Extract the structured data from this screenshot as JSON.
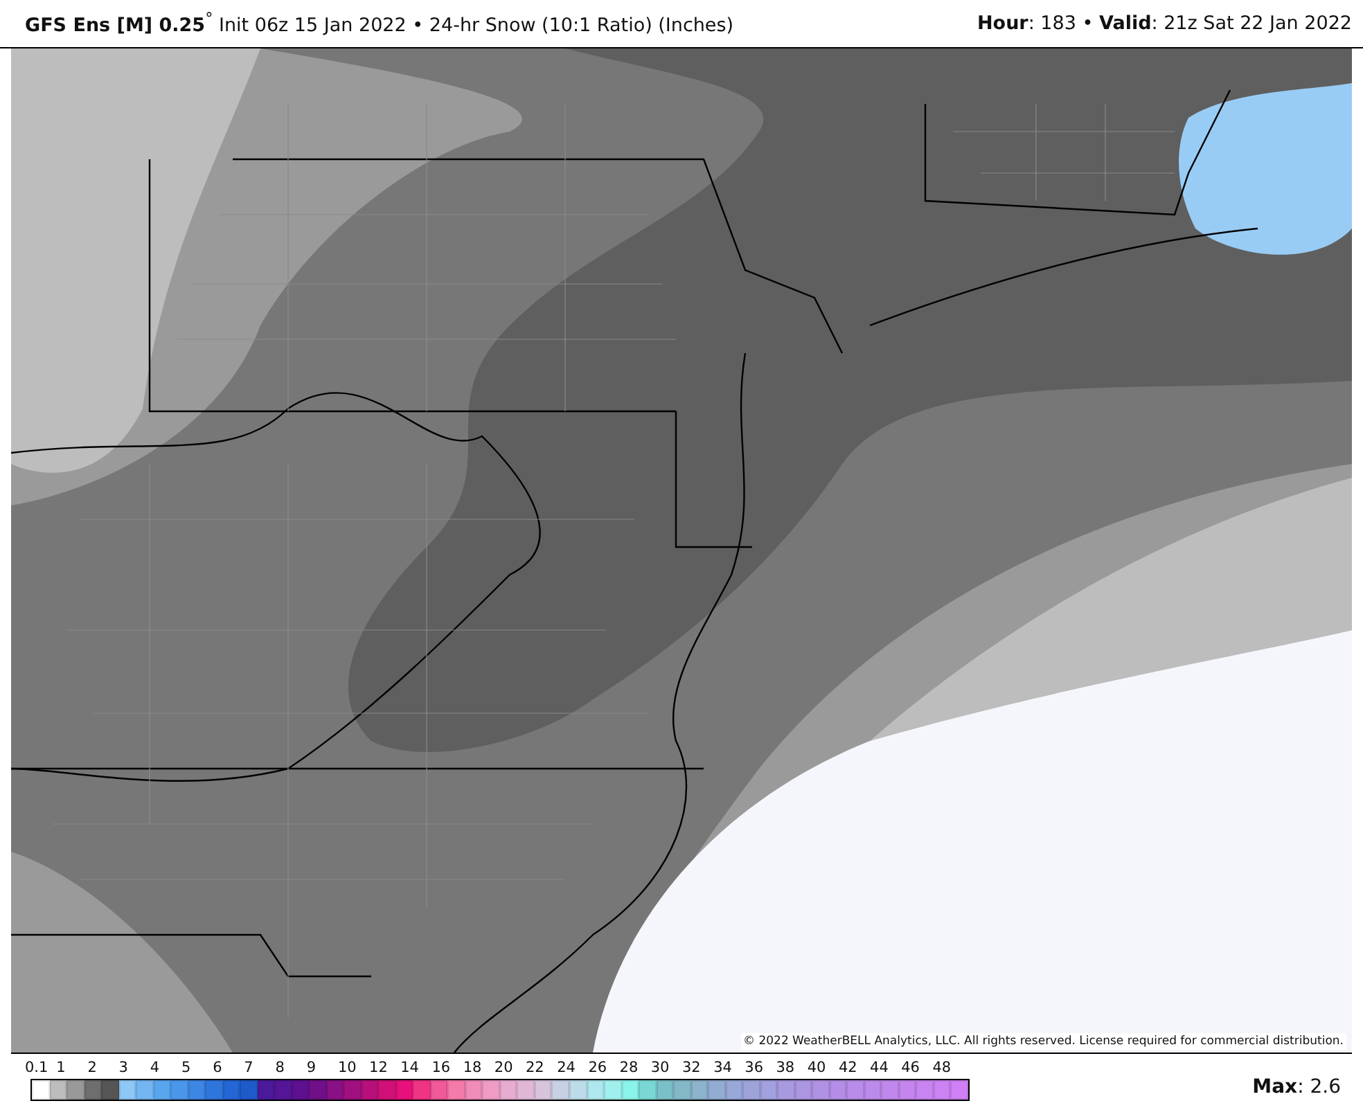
{
  "header": {
    "title": "**GFS Ens [M] 0.25**$^{°}$ Init 06z 15 Jan 2022 • 24-hr Snow (10:1 Ratio) (Inches)",
    "valid": "**Hour**: 183 • **Valid**: 21z Sat 22 Jan 2022"
  },
  "map": {
    "copyright": "© 2022 WeatherBELL Analytics, LLC. All rights reserved. License required for commercial distribution."
  },
  "legend": {
    "ticks": [
      "0.1",
      "1",
      "2",
      "3",
      "4",
      "5",
      "6",
      "7",
      "8",
      "9",
      "10",
      "12",
      "14",
      "16",
      "18",
      "20",
      "22",
      "24",
      "26",
      "28",
      "30",
      "32",
      "34",
      "36",
      "38",
      "40",
      "42",
      "44",
      "46",
      "48"
    ],
    "swatches": [
      {
        "color": "#ffffff"
      },
      {
        "color": "#bdbdbd"
      },
      {
        "color": "#999999"
      },
      {
        "color": "#6e6e6e"
      },
      {
        "color": "#555555"
      },
      {
        "color": "#8ec8f6"
      },
      {
        "color": "#74b6f2"
      },
      {
        "color": "#5aa6ee"
      },
      {
        "color": "#4a96ea"
      },
      {
        "color": "#3d86e4"
      },
      {
        "color": "#2f76dc"
      },
      {
        "color": "#2466d4"
      },
      {
        "color": "#1e5ac8"
      },
      {
        "color": "#4a1a9a"
      },
      {
        "color": "#541596"
      },
      {
        "color": "#5e1090"
      },
      {
        "color": "#701088"
      },
      {
        "color": "#8a1085"
      },
      {
        "color": "#a0107e"
      },
      {
        "color": "#b8107a"
      },
      {
        "color": "#d01078"
      },
      {
        "color": "#e8107a"
      },
      {
        "color": "#f03484"
      },
      {
        "color": "#f05a98"
      },
      {
        "color": "#f47aaa"
      },
      {
        "color": "#f08cb8"
      },
      {
        "color": "#ee9cc4"
      },
      {
        "color": "#e8acd0"
      },
      {
        "color": "#e0b8d6"
      },
      {
        "color": "#d8c4dc"
      },
      {
        "color": "#c8d0e4"
      },
      {
        "color": "#bcdcea"
      },
      {
        "color": "#aee8ee"
      },
      {
        "color": "#a0f0ee"
      },
      {
        "color": "#8af4ea"
      },
      {
        "color": "#7ad8d4"
      },
      {
        "color": "#7ac0c8"
      },
      {
        "color": "#84b8c8"
      },
      {
        "color": "#8cb2cc"
      },
      {
        "color": "#92acd2"
      },
      {
        "color": "#98a8d8"
      },
      {
        "color": "#9ea4da"
      },
      {
        "color": "#a2a0de"
      },
      {
        "color": "#a89ae0"
      },
      {
        "color": "#ac96e2"
      },
      {
        "color": "#b092e4"
      },
      {
        "color": "#b48ee6"
      },
      {
        "color": "#b88ce8"
      },
      {
        "color": "#bc8aea"
      },
      {
        "color": "#c088ec"
      },
      {
        "color": "#c486ee"
      },
      {
        "color": "#c884f0"
      },
      {
        "color": "#cc82f2"
      },
      {
        "color": "#d080f4"
      }
    ]
  },
  "max": "**Max**: 2.6"
}
